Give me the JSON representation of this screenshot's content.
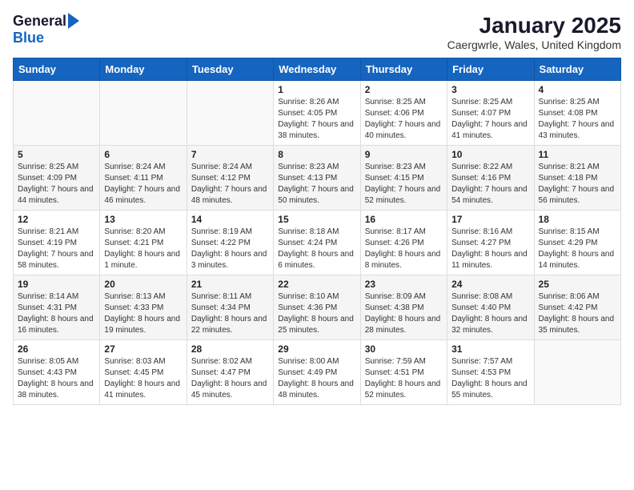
{
  "logo": {
    "general": "General",
    "blue": "Blue"
  },
  "title": "January 2025",
  "subtitle": "Caergwrle, Wales, United Kingdom",
  "weekdays": [
    "Sunday",
    "Monday",
    "Tuesday",
    "Wednesday",
    "Thursday",
    "Friday",
    "Saturday"
  ],
  "weeks": [
    [
      {
        "day": "",
        "sunrise": "",
        "sunset": "",
        "daylight": ""
      },
      {
        "day": "",
        "sunrise": "",
        "sunset": "",
        "daylight": ""
      },
      {
        "day": "",
        "sunrise": "",
        "sunset": "",
        "daylight": ""
      },
      {
        "day": "1",
        "sunrise": "Sunrise: 8:26 AM",
        "sunset": "Sunset: 4:05 PM",
        "daylight": "Daylight: 7 hours and 38 minutes."
      },
      {
        "day": "2",
        "sunrise": "Sunrise: 8:25 AM",
        "sunset": "Sunset: 4:06 PM",
        "daylight": "Daylight: 7 hours and 40 minutes."
      },
      {
        "day": "3",
        "sunrise": "Sunrise: 8:25 AM",
        "sunset": "Sunset: 4:07 PM",
        "daylight": "Daylight: 7 hours and 41 minutes."
      },
      {
        "day": "4",
        "sunrise": "Sunrise: 8:25 AM",
        "sunset": "Sunset: 4:08 PM",
        "daylight": "Daylight: 7 hours and 43 minutes."
      }
    ],
    [
      {
        "day": "5",
        "sunrise": "Sunrise: 8:25 AM",
        "sunset": "Sunset: 4:09 PM",
        "daylight": "Daylight: 7 hours and 44 minutes."
      },
      {
        "day": "6",
        "sunrise": "Sunrise: 8:24 AM",
        "sunset": "Sunset: 4:11 PM",
        "daylight": "Daylight: 7 hours and 46 minutes."
      },
      {
        "day": "7",
        "sunrise": "Sunrise: 8:24 AM",
        "sunset": "Sunset: 4:12 PM",
        "daylight": "Daylight: 7 hours and 48 minutes."
      },
      {
        "day": "8",
        "sunrise": "Sunrise: 8:23 AM",
        "sunset": "Sunset: 4:13 PM",
        "daylight": "Daylight: 7 hours and 50 minutes."
      },
      {
        "day": "9",
        "sunrise": "Sunrise: 8:23 AM",
        "sunset": "Sunset: 4:15 PM",
        "daylight": "Daylight: 7 hours and 52 minutes."
      },
      {
        "day": "10",
        "sunrise": "Sunrise: 8:22 AM",
        "sunset": "Sunset: 4:16 PM",
        "daylight": "Daylight: 7 hours and 54 minutes."
      },
      {
        "day": "11",
        "sunrise": "Sunrise: 8:21 AM",
        "sunset": "Sunset: 4:18 PM",
        "daylight": "Daylight: 7 hours and 56 minutes."
      }
    ],
    [
      {
        "day": "12",
        "sunrise": "Sunrise: 8:21 AM",
        "sunset": "Sunset: 4:19 PM",
        "daylight": "Daylight: 7 hours and 58 minutes."
      },
      {
        "day": "13",
        "sunrise": "Sunrise: 8:20 AM",
        "sunset": "Sunset: 4:21 PM",
        "daylight": "Daylight: 8 hours and 1 minute."
      },
      {
        "day": "14",
        "sunrise": "Sunrise: 8:19 AM",
        "sunset": "Sunset: 4:22 PM",
        "daylight": "Daylight: 8 hours and 3 minutes."
      },
      {
        "day": "15",
        "sunrise": "Sunrise: 8:18 AM",
        "sunset": "Sunset: 4:24 PM",
        "daylight": "Daylight: 8 hours and 6 minutes."
      },
      {
        "day": "16",
        "sunrise": "Sunrise: 8:17 AM",
        "sunset": "Sunset: 4:26 PM",
        "daylight": "Daylight: 8 hours and 8 minutes."
      },
      {
        "day": "17",
        "sunrise": "Sunrise: 8:16 AM",
        "sunset": "Sunset: 4:27 PM",
        "daylight": "Daylight: 8 hours and 11 minutes."
      },
      {
        "day": "18",
        "sunrise": "Sunrise: 8:15 AM",
        "sunset": "Sunset: 4:29 PM",
        "daylight": "Daylight: 8 hours and 14 minutes."
      }
    ],
    [
      {
        "day": "19",
        "sunrise": "Sunrise: 8:14 AM",
        "sunset": "Sunset: 4:31 PM",
        "daylight": "Daylight: 8 hours and 16 minutes."
      },
      {
        "day": "20",
        "sunrise": "Sunrise: 8:13 AM",
        "sunset": "Sunset: 4:33 PM",
        "daylight": "Daylight: 8 hours and 19 minutes."
      },
      {
        "day": "21",
        "sunrise": "Sunrise: 8:11 AM",
        "sunset": "Sunset: 4:34 PM",
        "daylight": "Daylight: 8 hours and 22 minutes."
      },
      {
        "day": "22",
        "sunrise": "Sunrise: 8:10 AM",
        "sunset": "Sunset: 4:36 PM",
        "daylight": "Daylight: 8 hours and 25 minutes."
      },
      {
        "day": "23",
        "sunrise": "Sunrise: 8:09 AM",
        "sunset": "Sunset: 4:38 PM",
        "daylight": "Daylight: 8 hours and 28 minutes."
      },
      {
        "day": "24",
        "sunrise": "Sunrise: 8:08 AM",
        "sunset": "Sunset: 4:40 PM",
        "daylight": "Daylight: 8 hours and 32 minutes."
      },
      {
        "day": "25",
        "sunrise": "Sunrise: 8:06 AM",
        "sunset": "Sunset: 4:42 PM",
        "daylight": "Daylight: 8 hours and 35 minutes."
      }
    ],
    [
      {
        "day": "26",
        "sunrise": "Sunrise: 8:05 AM",
        "sunset": "Sunset: 4:43 PM",
        "daylight": "Daylight: 8 hours and 38 minutes."
      },
      {
        "day": "27",
        "sunrise": "Sunrise: 8:03 AM",
        "sunset": "Sunset: 4:45 PM",
        "daylight": "Daylight: 8 hours and 41 minutes."
      },
      {
        "day": "28",
        "sunrise": "Sunrise: 8:02 AM",
        "sunset": "Sunset: 4:47 PM",
        "daylight": "Daylight: 8 hours and 45 minutes."
      },
      {
        "day": "29",
        "sunrise": "Sunrise: 8:00 AM",
        "sunset": "Sunset: 4:49 PM",
        "daylight": "Daylight: 8 hours and 48 minutes."
      },
      {
        "day": "30",
        "sunrise": "Sunrise: 7:59 AM",
        "sunset": "Sunset: 4:51 PM",
        "daylight": "Daylight: 8 hours and 52 minutes."
      },
      {
        "day": "31",
        "sunrise": "Sunrise: 7:57 AM",
        "sunset": "Sunset: 4:53 PM",
        "daylight": "Daylight: 8 hours and 55 minutes."
      },
      {
        "day": "",
        "sunrise": "",
        "sunset": "",
        "daylight": ""
      }
    ]
  ]
}
